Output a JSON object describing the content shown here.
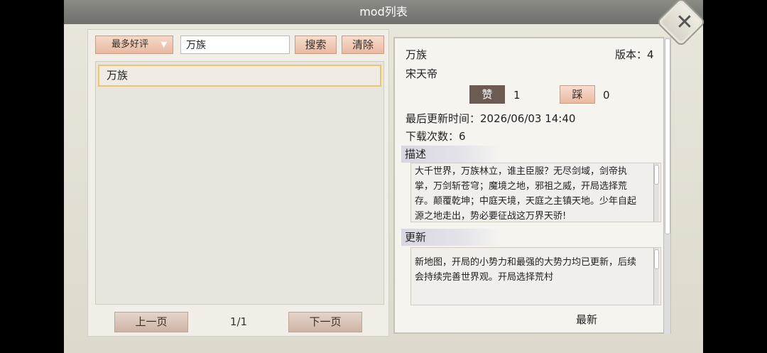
{
  "window": {
    "title": "mod列表"
  },
  "filters": {
    "sort_label": "最多好评",
    "search_value": "万族",
    "search_button": "搜索",
    "clear_button": "清除"
  },
  "mod_list": [
    {
      "name": "万族"
    }
  ],
  "pager": {
    "prev": "上一页",
    "indicator": "1/1",
    "next": "下一页"
  },
  "detail": {
    "name": "万族",
    "version": "版本：4",
    "author": "宋天帝",
    "like_label": "赞",
    "like_count": "1",
    "dislike_label": "踩",
    "dislike_count": "0",
    "updated": "最后更新时间：2026/06/03 14:40",
    "downloads": "下载次数：6",
    "desc_heading": "描述",
    "description": "大千世界，万族林立，谁主臣服？无尽剑域，剑帝执掌，万剑斩苍穹；魔境之地，邪祖之威，开局选择荒存。颠覆乾坤；中庭天境，天庭之主镇天地。少年自起源之地走出，势必要征战这万界天骄!",
    "update_heading": "更新",
    "update_notes": "新地图，开局的小势力和最强的大势力均已更新，后续会持续完善世界观。开局选择荒村",
    "latest_button": "最新"
  },
  "icons": {
    "close": "close-icon",
    "dropdown": "chevron-down-icon"
  }
}
